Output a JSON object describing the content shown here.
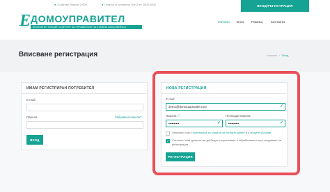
{
  "topbar": {
    "version": "Софтуер Версия 2.000",
    "phone": "Помощ от оператор Пон-Пет 1000-1600",
    "login_button": "ВХОД/РЕГИСТРАЦИЯ"
  },
  "header": {
    "logo_mark": "Е",
    "logo_text": "ДОМОУПРАВИТЕЛ",
    "logo_tagline": "БЕЗПЛАТЕН ОНЛАЙН СОФТУЕР ЗА УПРАВЛЕНИЕ НА ЕТАЖНА СОБСТВЕНОСТ",
    "nav": [
      "Начало",
      "Блог",
      "Помощ",
      "Контакти"
    ]
  },
  "title_band": {
    "title": "Вписване регистрация",
    "breadcrumb_home": "Начало",
    "breadcrumb_current": "Вход"
  },
  "login": {
    "heading": "ИМАМ РЕГИСТРИРАН ПОТРЕБИТЕЛ",
    "email_label": "E-mail",
    "password_label": "Парола",
    "forgot_link": "Забравена парола?",
    "submit": "ВХОД"
  },
  "register": {
    "heading": "НОВА РЕГИСТРАЦИЯ",
    "email_label": "E-mail",
    "email_value": "demo@domouupravitel.com",
    "password_label": "Парола",
    "confirm_label": "Потвърди парола",
    "password_mask": "••••••••••",
    "confirm_mask": "••••••••••",
    "agree_1_pre": "Запознат съм с ",
    "agree_1_link1": "политиката за защита на личните данни",
    "agree_1_mid": " и с ",
    "agree_1_link2": "общите условия",
    "agree_2": "Съгласен съм данните ми да бъдат съхранявани и обработвани с цел създаване на регистрация",
    "submit": "РЕГИСТРАЦИЯ"
  },
  "colors": {
    "accent": "#16a394",
    "highlight": "#e9505a"
  }
}
